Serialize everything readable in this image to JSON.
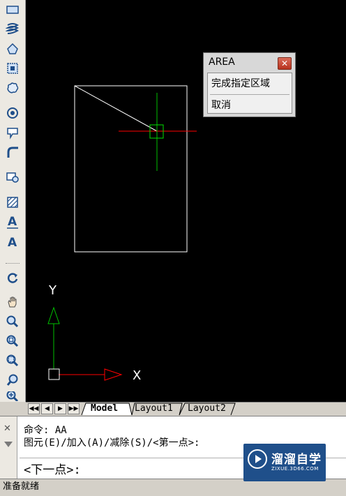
{
  "toolbar": {
    "tools": [
      {
        "name": "rectangle-icon"
      },
      {
        "name": "helix-icon"
      },
      {
        "name": "region-icon"
      },
      {
        "name": "block-icon"
      },
      {
        "name": "revision-cloud-icon"
      },
      {
        "name": "donut-icon"
      },
      {
        "name": "wipeout-icon"
      },
      {
        "name": "fillet-icon"
      },
      {
        "name": "insert-table-icon"
      },
      {
        "name": "hatch-icon"
      },
      {
        "name": "multiline-text-icon"
      },
      {
        "name": "single-text-icon"
      },
      {
        "name": "regen-icon"
      },
      {
        "name": "pan-icon"
      },
      {
        "name": "zoom-realtime-icon"
      },
      {
        "name": "zoom-window-icon"
      },
      {
        "name": "zoom-extents-icon"
      },
      {
        "name": "zoom-previous-icon"
      },
      {
        "name": "zoom-in-icon"
      }
    ]
  },
  "canvas": {
    "background": "#000000",
    "ucs": {
      "x_label": "X",
      "y_label": "Y"
    },
    "colors": {
      "crosshair_x": "#ff0000",
      "crosshair_y": "#00c000",
      "geometry": "#ffffff"
    }
  },
  "popup": {
    "title": "AREA",
    "close_label": "✕",
    "items": [
      "完成指定区域",
      "取消"
    ]
  },
  "tabs": {
    "nav": [
      "◀◀",
      "◀",
      "▶",
      "▶▶"
    ],
    "items": [
      "Model",
      "Layout1",
      "Layout2"
    ],
    "active": "Model"
  },
  "command": {
    "history": [
      "命令: AA",
      "图元(E)/加入(A)/减除(S)/<第一点>:"
    ],
    "prompt": "<下一点>:",
    "grip_close": "✕"
  },
  "status": {
    "text": "准备就绪"
  },
  "watermark": {
    "brand": "溜溜自学",
    "url": "ZIXUE.3D66.COM"
  }
}
